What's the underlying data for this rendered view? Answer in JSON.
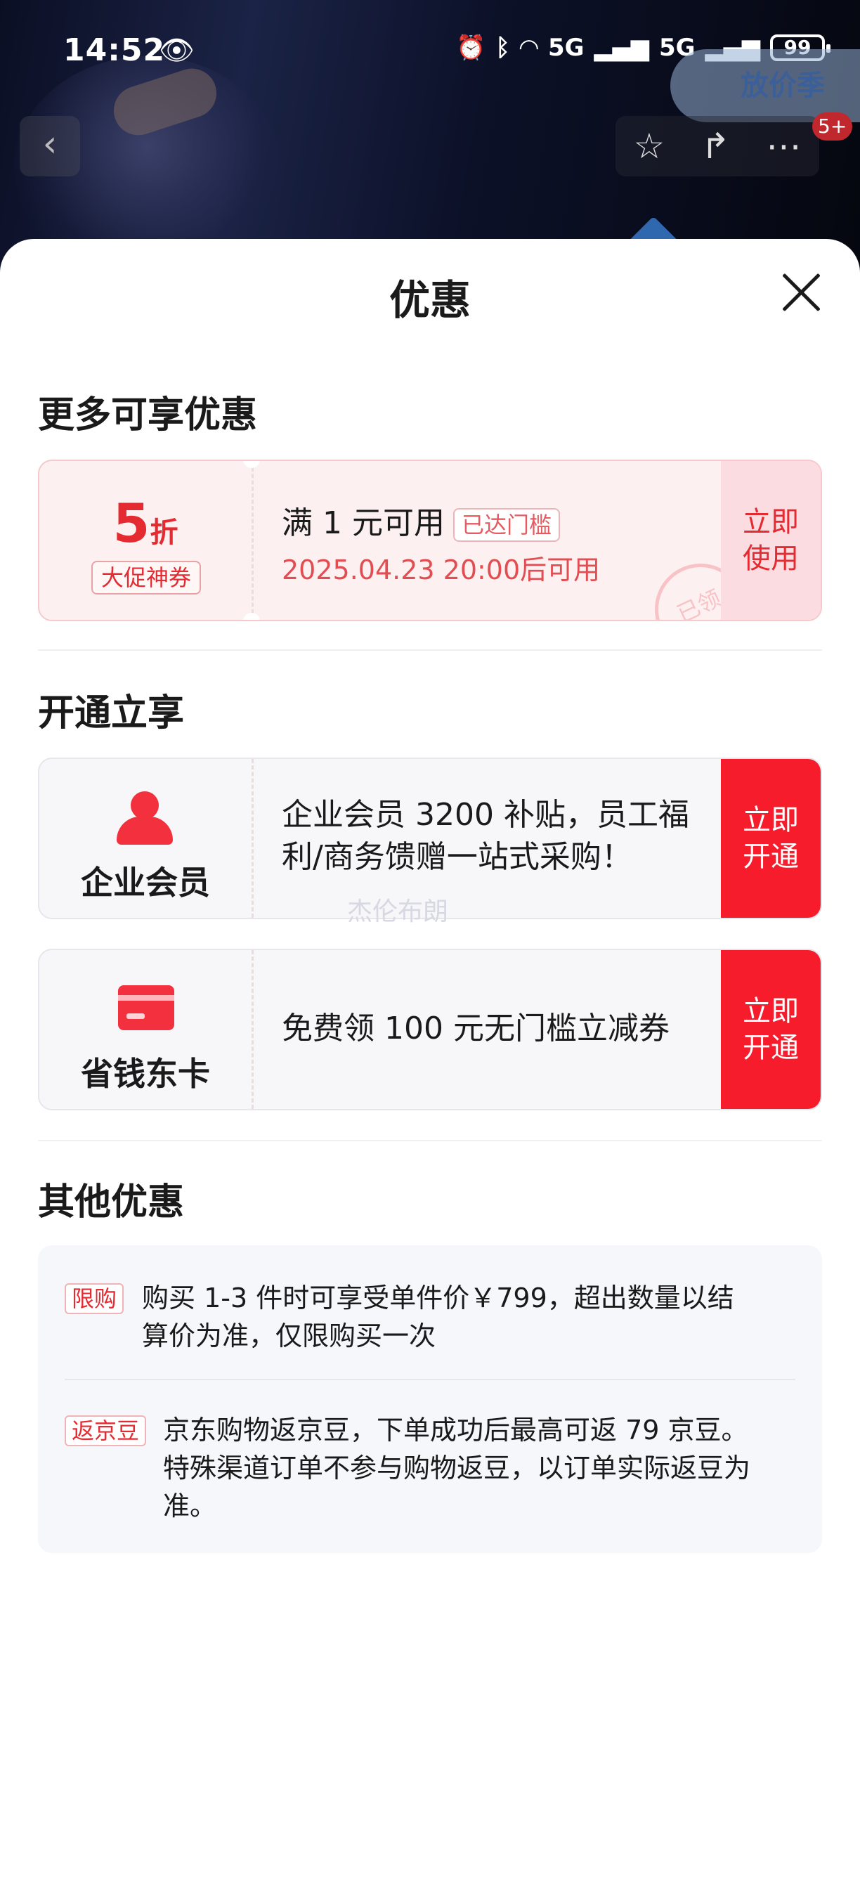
{
  "status_bar": {
    "time": "14:52",
    "eye_icon": "eye-icon",
    "network": "5G",
    "battery": "99"
  },
  "top_badge": {
    "label": "放价季"
  },
  "nav": {
    "back_icon": "chevron-left-icon",
    "star_icon": "star-icon",
    "share_icon": "share-icon",
    "more_icon": "more-icon",
    "badge": "5+"
  },
  "sheet": {
    "title": "优惠"
  },
  "sections": {
    "more": "更多可享优惠",
    "open": "开通立享",
    "other": "其他优惠"
  },
  "coupon": {
    "discount": "5",
    "discount_unit": "折",
    "tag": "大促神券",
    "condition": "满 1 元可用",
    "threshold": "已达门槛",
    "time": "2025.04.23 20:00后可用",
    "stamp": "已领",
    "action": "立即\n使用"
  },
  "members": [
    {
      "label": "企业会员",
      "icon": "person-icon",
      "text": "企业会员 3200 补贴，员工福利/商务馈赠一站式采购！",
      "action": "立即\n开通"
    },
    {
      "label": "省钱东卡",
      "icon": "card-icon",
      "text": "免费领 100 元无门槛立减券",
      "action": "立即\n开通"
    }
  ],
  "watermark": "杰伦布朗",
  "other_offers": [
    {
      "tag": "限购",
      "text": "购买 1-3 件时可享受单件价￥799，超出数量以结算价为准，仅限购买一次"
    },
    {
      "tag": "返京豆",
      "text": "京东购物返京豆，下单成功后最高可返 79 京豆。特殊渠道订单不参与购物返豆，以订单实际返豆为准。"
    }
  ],
  "colors": {
    "accent_red": "#f61c2b",
    "coupon_bg": "#fdf0f1",
    "coupon_text": "#e52b32"
  }
}
